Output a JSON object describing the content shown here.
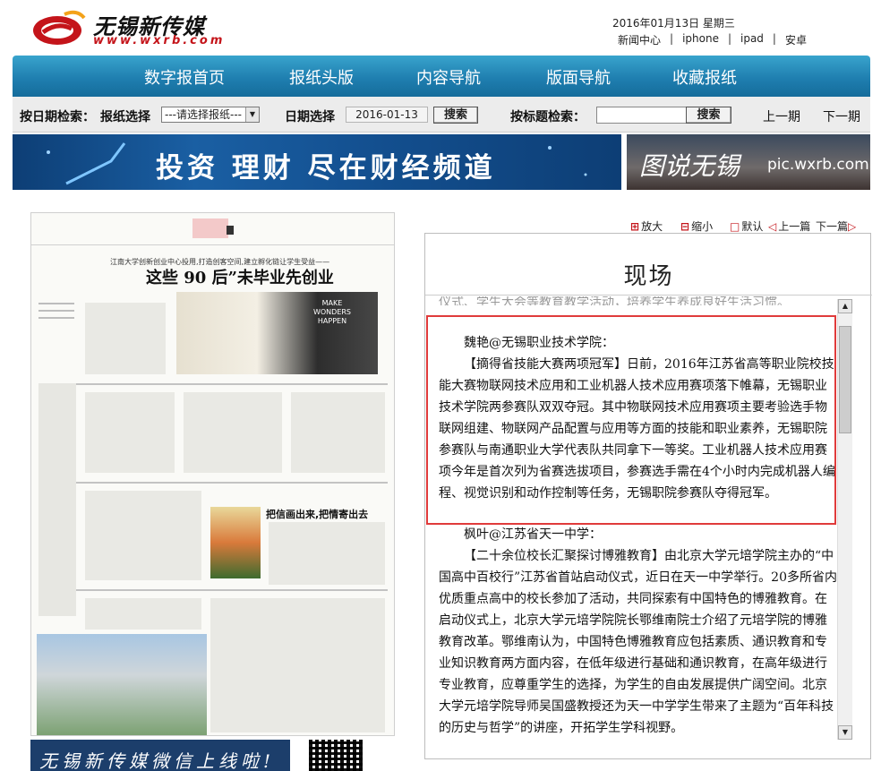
{
  "header": {
    "logo_title": "无锡新传媒",
    "logo_url": "www.wxrb.com",
    "date": "2016年01月13日 星期三",
    "links": [
      "新闻中心",
      "iphone",
      "ipad",
      "安卓"
    ]
  },
  "nav": [
    "数字报首页",
    "报纸头版",
    "内容导航",
    "版面导航",
    "收藏报纸"
  ],
  "search": {
    "by_date_label": "按日期检索：",
    "paper_select_label": "报纸选择",
    "paper_select_value": "---请选择报纸---",
    "date_label": "日期选择",
    "date_value": "2016-01-13",
    "search_button": "搜索",
    "title_search_label": "按标题检索：",
    "title_search_button": "搜索",
    "prev_page": "上一期",
    "next_page": "下一期"
  },
  "banners": {
    "left": "投资 理财  尽在财经频道",
    "right_title": "图说无锡",
    "right_url": "pic.wxrb.com"
  },
  "paper": {
    "kicker": "江南大学创新创业中心投用,打造创客空间,建立孵化链让学生受益——",
    "headline": "这些 90 后”未毕业先创业",
    "photo_text": "MAKE WONDERS HAPPEN",
    "sub_headline": "把信画出来,把情寄出去"
  },
  "weixin": {
    "text": "无锡新传媒微信上线啦!"
  },
  "zoom": {
    "enlarge": "放大",
    "shrink": "缩小",
    "default": "默认",
    "prev": "上一篇",
    "next": "下一篇"
  },
  "article": {
    "title": "现场",
    "clipped_line": "仪式、学生大会等教育教学活动，培养学生养成良好生活习惯。",
    "p1": "魏艳@无锡职业技术学院：",
    "p2": "【摘得省技能大赛两项冠军】日前，2016年江苏省高等职业院校技能大赛物联网技术应用和工业机器人技术应用赛项落下帷幕，无锡职业技术学院两参赛队双双夺冠。其中物联网技术应用赛项主要考验选手物联网组建、物联网产品配置与应用等方面的技能和职业素养，无锡职院参赛队与南通职业大学代表队共同拿下一等奖。工业机器人技术应用赛项今年是首次列为省赛选拔项目，参赛选手需在4个小时内完成机器人编程、视觉识别和动作控制等任务，无锡职院参赛队夺得冠军。",
    "p3": "枫叶@江苏省天一中学：",
    "p4": "【二十余位校长汇聚探讨博雅教育】由北京大学元培学院主办的“中国高中百校行”江苏省首站启动仪式，近日在天一中学举行。20多所省内优质重点高中的校长参加了活动，共同探索有中国特色的博雅教育。在启动仪式上，北京大学元培学院院长鄂维南院士介绍了元培学院的博雅教育改革。鄂维南认为，中国特色博雅教育应包括素质、通识教育和专业知识教育两方面内容，在低年级进行基础和通识教育，在高年级进行专业教育，应尊重学生的选择，为学生的自由发展提供广阔空间。北京大学元培学院导师吴国盛教授还为天一中学学生带来了主题为“百年科技的历史与哲学”的讲座，开拓学生学科视野。"
  },
  "colors": {
    "nav_blue": "#1f7fb0",
    "brand_red": "#c4141a",
    "highlight": "#e03b3b"
  }
}
